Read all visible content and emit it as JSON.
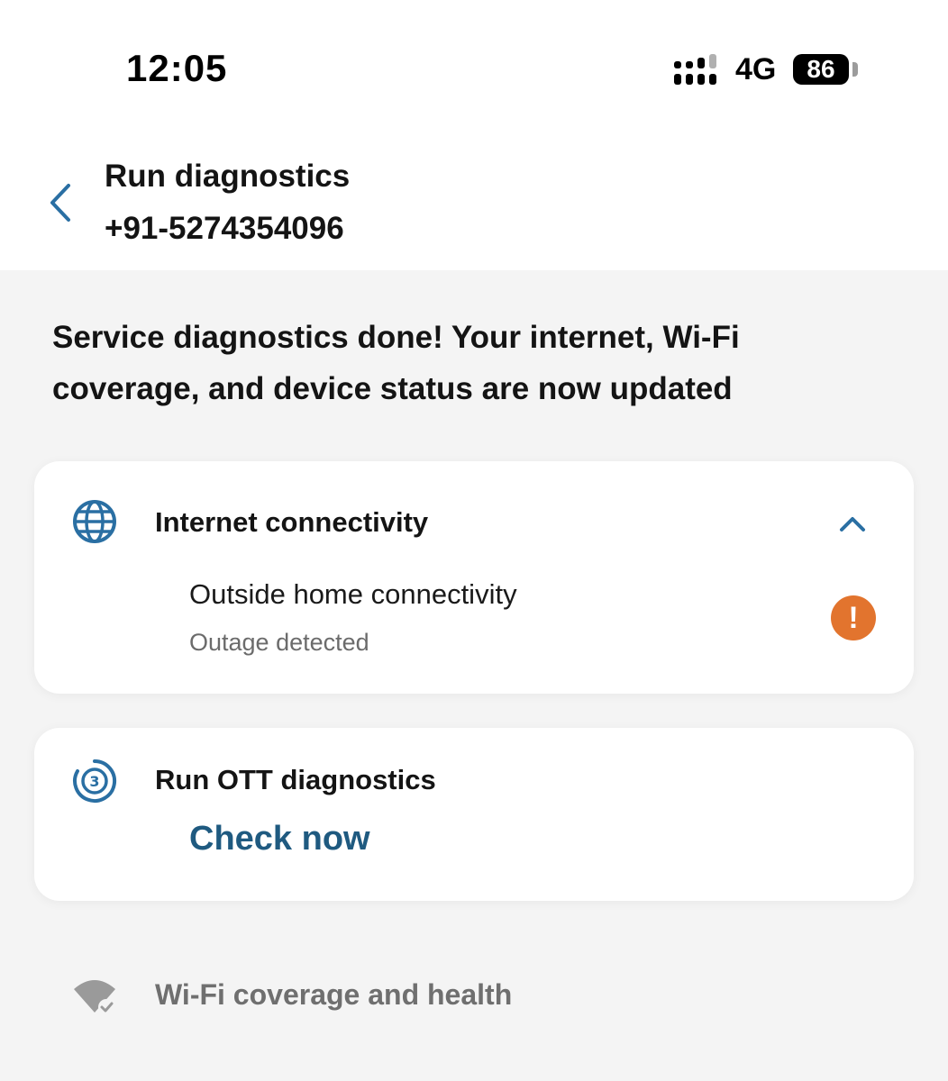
{
  "status_bar": {
    "time": "12:05",
    "network": "4G",
    "battery": "86"
  },
  "header": {
    "title": "Run diagnostics",
    "subtitle": "+91-5274354096"
  },
  "intro_text": "Service diagnostics done! Your internet, Wi-Fi coverage, and device status are now updated",
  "internet_card": {
    "title": "Internet connectivity",
    "icon": "globe-icon",
    "row": {
      "title": "Outside home connectivity",
      "status": "Outage detected",
      "badge_icon": "exclamation-icon",
      "badge_symbol": "!"
    }
  },
  "ott_card": {
    "title": "Run OTT diagnostics",
    "icon": "ott-icon",
    "action_label": "Check now"
  },
  "wifi_section": {
    "label": "Wi-Fi coverage and health",
    "icon": "wifi-check-icon"
  },
  "colors": {
    "accent": "#1f5a80",
    "icon_blue": "#2a6fa3",
    "warning": "#e2742e",
    "muted_text": "#6b6b6b",
    "background": "#f4f4f4"
  }
}
